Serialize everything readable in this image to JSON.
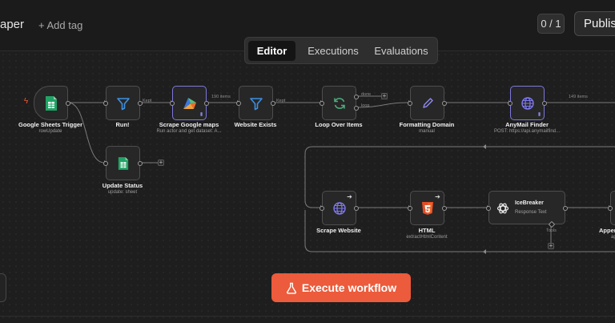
{
  "header": {
    "title": "aper",
    "add_tag": "+ Add tag",
    "counter": "0 / 1",
    "publish": "Publish"
  },
  "tabs": [
    {
      "label": "Editor",
      "active": true
    },
    {
      "label": "Executions",
      "active": false
    },
    {
      "label": "Evaluations",
      "active": false
    }
  ],
  "nodes": {
    "google_sheets_trigger": {
      "label": "Google Sheets Trigger",
      "sub": "rowUpdate",
      "icon": "google-sheets-icon"
    },
    "run": {
      "label": "Run!",
      "icon": "filter-icon"
    },
    "scrape_google_maps": {
      "label": "Scrape Google maps",
      "sub": "Run actor and get dataset: A...",
      "icon": "apify-icon"
    },
    "website_exists": {
      "label": "Website Exists",
      "icon": "filter-icon"
    },
    "update_status": {
      "label": "Update Status",
      "sub": "update: sheet",
      "icon": "google-sheets-icon"
    },
    "loop_over_items": {
      "label": "Loop Over Items",
      "icon": "loop-icon"
    },
    "formatting_domain": {
      "label": "Formatting Domain",
      "sub": "manual",
      "icon": "pencil-icon"
    },
    "anymail_finder": {
      "label": "AnyMail Finder",
      "sub": "POST: https://api.anymailfind...",
      "icon": "globe-icon"
    },
    "scrape_website": {
      "label": "Scrape Website",
      "icon": "globe-icon"
    },
    "html": {
      "label": "HTML",
      "sub": "extractHtmlContent",
      "icon": "html5-icon"
    },
    "icebreaker": {
      "title": "IceBreaker",
      "sub": "Response Text",
      "icon": "openai-icon"
    },
    "append": {
      "label": "Appen",
      "sub": "ap"
    }
  },
  "edges": {
    "kept_1": "Kept",
    "items_190": "190 items",
    "kept_2": "Kept",
    "done": "done",
    "loop": "loop",
    "items_149": "149 items",
    "tools": "Tools"
  },
  "colors": {
    "accent": "#ec5b3b",
    "selected_border": "#7d78d9",
    "sheets_green": "#21a366",
    "filter_blue": "#3d8fe0",
    "loop_green": "#4caf7d",
    "html_orange": "#e44d26",
    "globe_purple": "#7f79ee"
  },
  "execute_button": "Execute workflow"
}
